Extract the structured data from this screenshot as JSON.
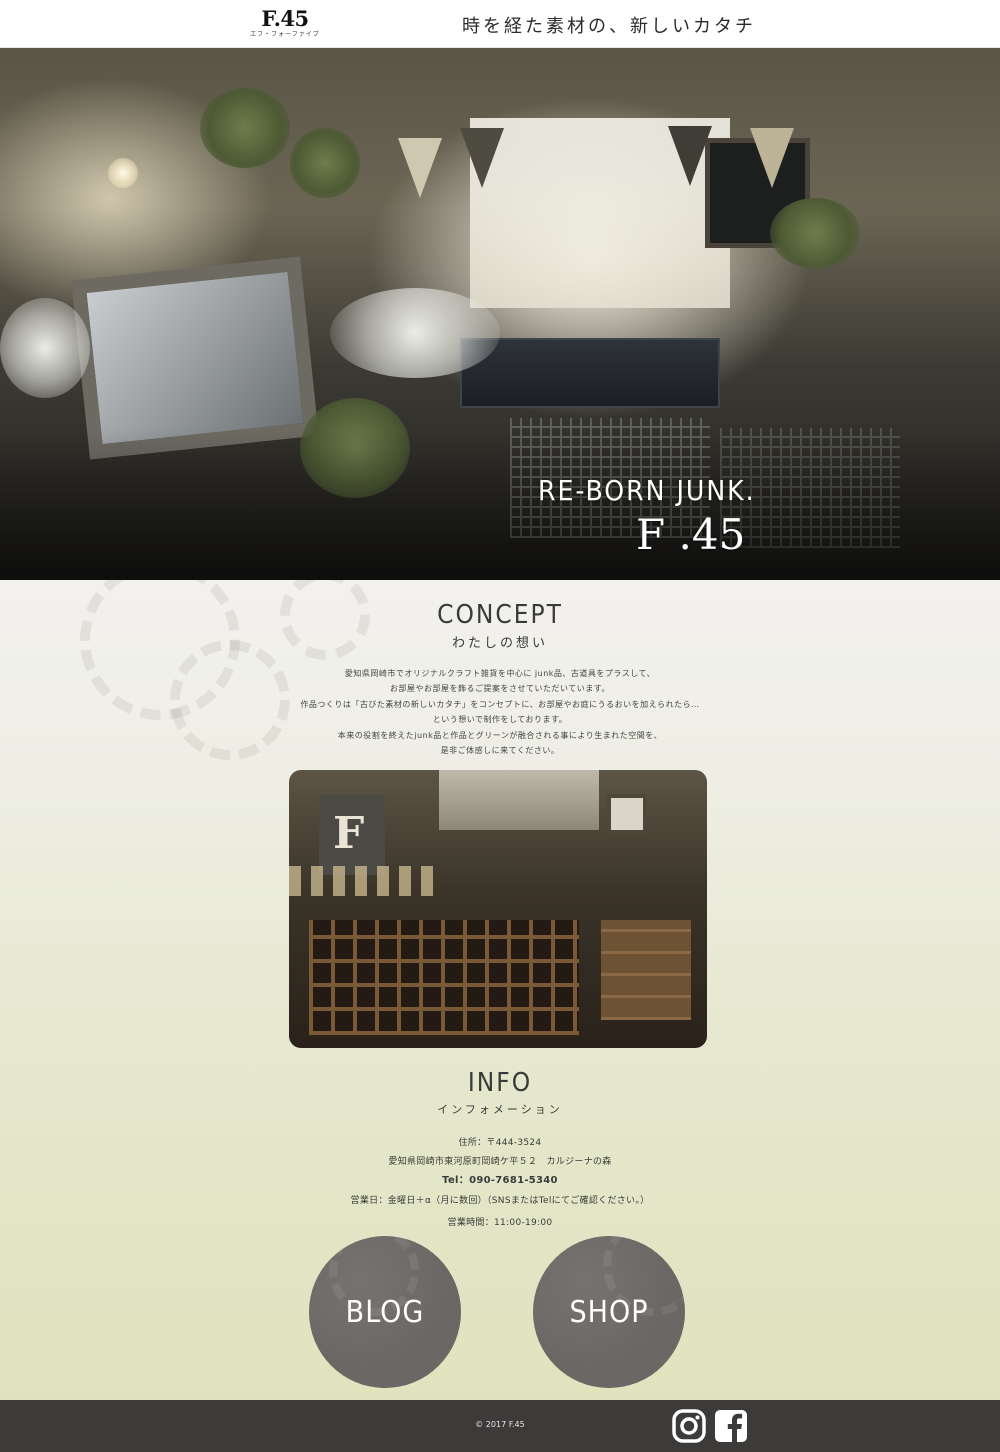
{
  "header": {
    "logo_main": "F.45",
    "logo_sub": "エフ・フォーファイブ",
    "tagline": "時を経た素材の、新しいカタチ"
  },
  "hero": {
    "headline": "RE-BORN JUNK.",
    "brand": "F .45"
  },
  "concept": {
    "title": "CONCEPT",
    "subtitle": "わたしの想い",
    "lines": [
      "愛知県岡崎市でオリジナルクラフト雑貨を中心に junk品、古道具をプラスして、",
      "お部屋やお部屋を飾るご提案をさせていただいています。",
      "作品つくりは「古びた素材の新しいカタチ」をコンセプトに、お部屋やお庭にうるおいを加えられたら…",
      "という想いで制作をしております。",
      "本来の役割を終えたjunk品と作品とグリーンが融合される事により生まれた空間を、",
      "是非ご体感しに来てください。"
    ]
  },
  "info": {
    "title": "INFO",
    "subtitle": "インフォメーション",
    "postal": "住所：〒444-3524",
    "address": "愛知県岡崎市東河原町岡崎ケ平５２　カルジーナの森",
    "tel": "Tel：090-7681-5340",
    "business_days": "営業日：金曜日＋α（月に数回）（SNSまたはTelにてご確認ください。）",
    "hours": "営業時間：11:00-19:00"
  },
  "buttons": {
    "blog": "BLOG",
    "shop": "SHOP"
  },
  "footer": {
    "copyright": "© 2017 F.45",
    "icons": [
      "instagram-icon",
      "facebook-icon"
    ]
  },
  "colors": {
    "footer_bg": "#3d3b3a",
    "button_bg": "#6a6764",
    "content_gradient_top": "#f2f1ee",
    "content_gradient_bottom": "#dfe3bd"
  }
}
